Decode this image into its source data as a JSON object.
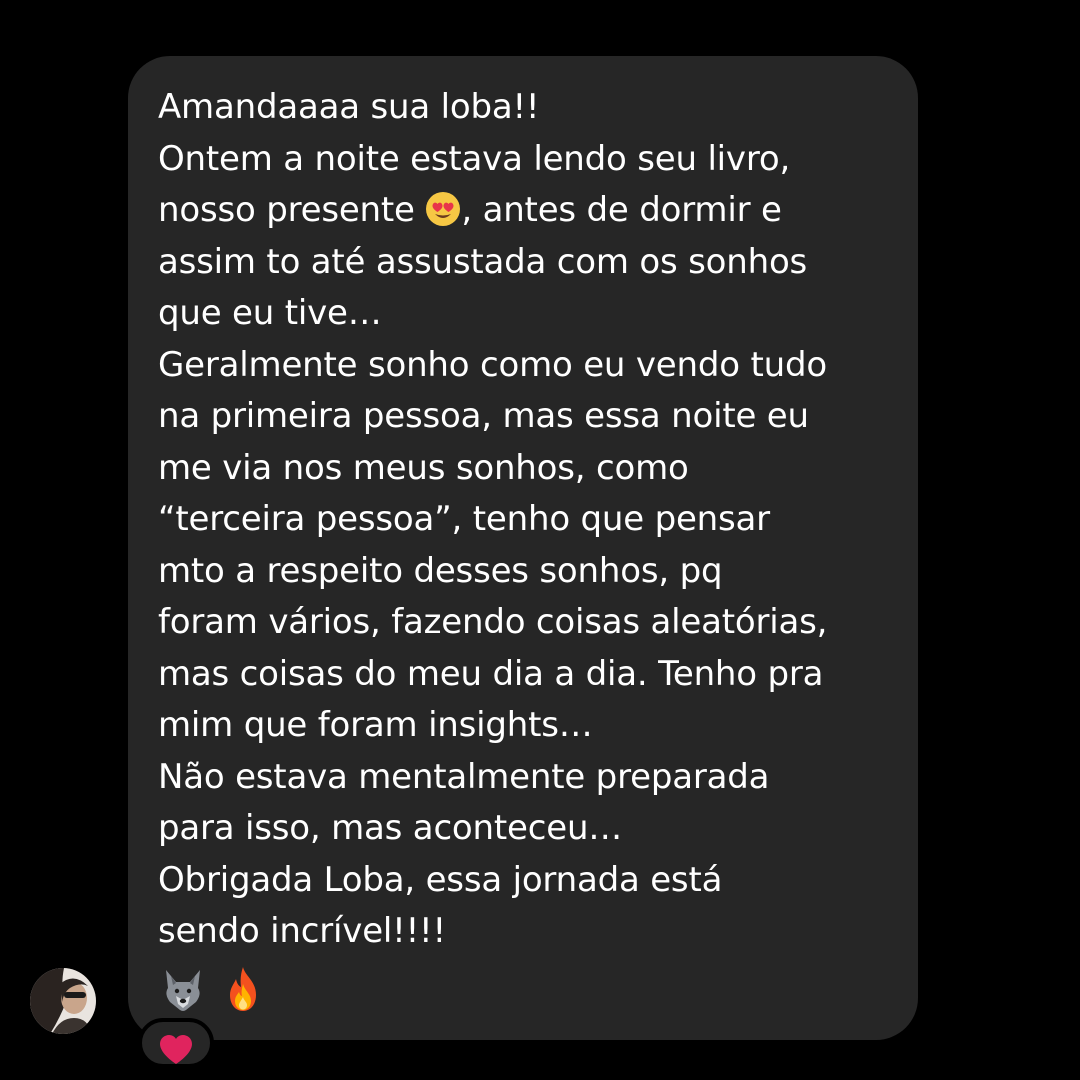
{
  "message": {
    "lines": [
      "Amandaaaa sua loba!!",
      "Ontem a noite estava lendo seu livro,",
      "nosso presente",
      ", antes de dormir e",
      "assim to até assustada com os sonhos",
      "que eu tive…",
      "Geralmente sonho como eu vendo tudo",
      "na primeira pessoa, mas essa noite eu",
      "me via nos meus sonhos, como",
      "“terceira pessoa”, tenho que pensar",
      "mto a respeito desses sonhos, pq",
      "foram vários, fazendo coisas aleatórias,",
      "mas coisas do meu dia a dia. Tenho pra",
      "mim que foram insights…",
      "Não estava mentalmente preparada",
      "para isso, mas aconteceu…",
      "Obrigada Loba, essa jornada está",
      "sendo incrível!!!!"
    ],
    "inline_emoji": "heart-eyes-emoji",
    "trailing_emojis": [
      "wolf-emoji",
      "fire-emoji"
    ]
  },
  "reaction": {
    "emoji": "heart-emoji",
    "color": "#e0245e"
  },
  "colors": {
    "background": "#000000",
    "bubble": "#262626",
    "text": "#ffffff"
  }
}
